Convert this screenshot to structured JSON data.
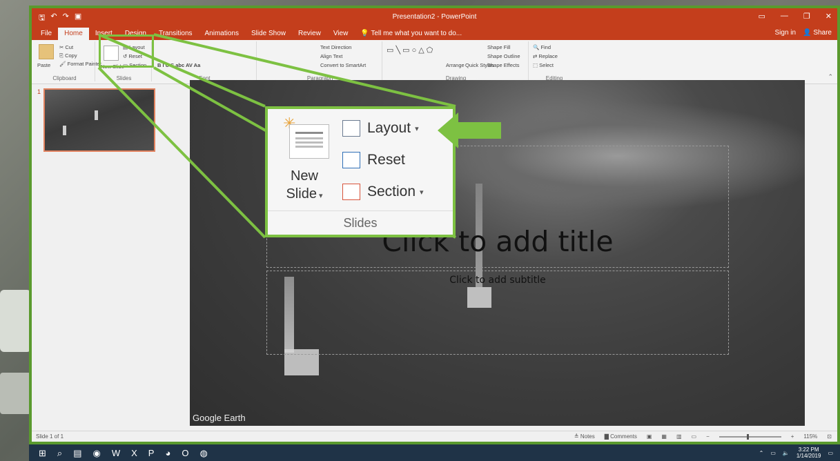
{
  "window": {
    "title": "Presentation2 - PowerPoint",
    "controls": [
      "▭",
      "—",
      "❐",
      "✕"
    ]
  },
  "tabs": {
    "items": [
      "File",
      "Home",
      "Insert",
      "Design",
      "Transitions",
      "Animations",
      "Slide Show",
      "Review",
      "View",
      "Tell me what you want to do..."
    ],
    "active": "Home",
    "sign_in": "Sign in",
    "share": "Share"
  },
  "ribbon": {
    "clipboard": {
      "name": "Clipboard",
      "paste": "Paste",
      "cut": "Cut",
      "copy": "Copy",
      "format_painter": "Format Painter"
    },
    "slides": {
      "name": "Slides",
      "new_slide": "New Slide",
      "layout": "Layout",
      "reset": "Reset",
      "section": "Section"
    },
    "font": {
      "name": "Font"
    },
    "paragraph": {
      "name": "Paragraph",
      "text_direction": "Text Direction",
      "align_text": "Align Text",
      "smartart": "Convert to SmartArt"
    },
    "drawing": {
      "name": "Drawing",
      "arrange": "Arrange",
      "quick_styles": "Quick Styles",
      "shape_fill": "Shape Fill",
      "shape_outline": "Shape Outline",
      "shape_effects": "Shape Effects"
    },
    "editing": {
      "name": "Editing",
      "find": "Find",
      "replace": "Replace",
      "select": "Select"
    }
  },
  "thumbnails": {
    "number": "1"
  },
  "slide": {
    "title_placeholder": "Click to add title",
    "subtitle_placeholder": "Click to add subtitle",
    "image_credit": "Google Earth"
  },
  "callout": {
    "new_slide_line1": "New",
    "new_slide_line2": "Slide",
    "layout": "Layout",
    "reset": "Reset",
    "section": "Section",
    "group_name": "Slides",
    "highlight_color": "#7dc142"
  },
  "statusbar": {
    "slide_count": "Slide 1 of 1",
    "notes": "Notes",
    "comments": "Comments",
    "zoom": "115%"
  },
  "taskbar": {
    "time": "3:22 PM",
    "date": "1/14/2019"
  }
}
